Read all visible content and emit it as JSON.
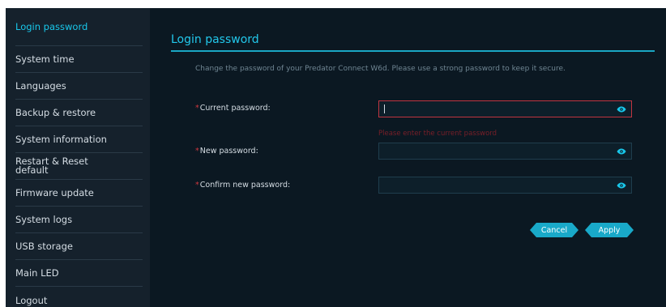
{
  "sidebar": {
    "items": [
      {
        "label": "Login password",
        "active": true
      },
      {
        "label": "System time"
      },
      {
        "label": "Languages"
      },
      {
        "label": "Backup & restore"
      },
      {
        "label": "System information"
      },
      {
        "label": "Restart & Reset default"
      },
      {
        "label": "Firmware update"
      },
      {
        "label": "System logs"
      },
      {
        "label": "USB storage"
      },
      {
        "label": "Main LED"
      },
      {
        "label": "Logout"
      }
    ]
  },
  "main": {
    "title": "Login password",
    "description": "Change the password of your Predator Connect W6d. Please use a strong password to keep it secure.",
    "required_mark": "*",
    "fields": {
      "current": {
        "label": "Current password:",
        "value": "",
        "error": "Please enter the current password"
      },
      "new": {
        "label": "New password:",
        "value": ""
      },
      "confirm": {
        "label": "Confirm new password:",
        "value": ""
      }
    },
    "buttons": {
      "cancel": "Cancel",
      "apply": "Apply"
    }
  },
  "colors": {
    "accent": "#18c7ea",
    "background": "#0b1822",
    "sidebar": "#15212c",
    "error": "#c03440"
  },
  "icons": {
    "show_password": "eye-icon"
  }
}
